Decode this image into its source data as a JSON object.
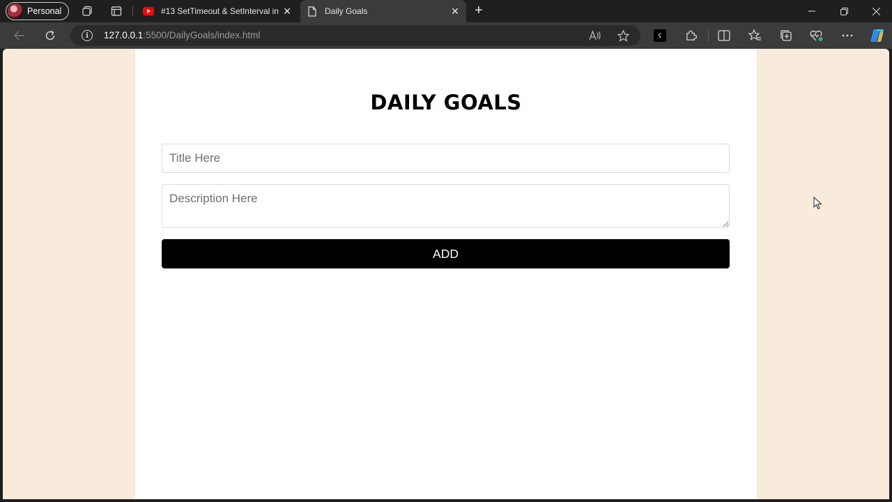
{
  "browser": {
    "profile_label": "Personal",
    "tabs": [
      {
        "title": "#13 SetTimeout & SetInterval in",
        "favicon": "youtube-icon",
        "active": false
      },
      {
        "title": "Daily Goals",
        "favicon": "page-icon",
        "active": true
      }
    ],
    "address": {
      "host": "127.0.0.1",
      "rest": ":5500/DailyGoals/index.html"
    }
  },
  "page": {
    "title": "DAILY GOALS",
    "title_placeholder": "Title Here",
    "description_placeholder": "Description Here",
    "add_label": "ADD"
  },
  "colors": {
    "page_background": "#f8ebdb",
    "container": "#ffffff",
    "button": "#000000",
    "youtube_red": "#ff0000"
  }
}
